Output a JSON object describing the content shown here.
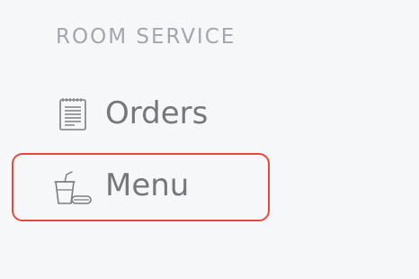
{
  "sidebar": {
    "section_title": "ROOM SERVICE",
    "items": [
      {
        "label": "Orders",
        "icon": "notepad-icon",
        "selected": false
      },
      {
        "label": "Menu",
        "icon": "drink-and-food-icon",
        "selected": true
      }
    ]
  },
  "colors": {
    "background": "#f6f7f9",
    "section_title": "#a4a6ab",
    "item_text": "#75777b",
    "icon_stroke": "#7c7e82",
    "selected_border": "#e8473a"
  }
}
